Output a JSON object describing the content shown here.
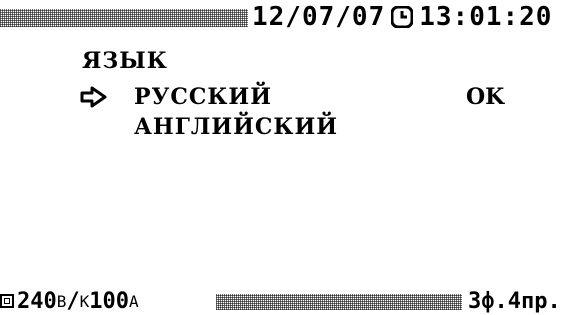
{
  "status_bar": {
    "date": "12/07/07",
    "time": "13:01:20"
  },
  "menu": {
    "title": "ЯЗЫК",
    "items": [
      {
        "label": "РУССКИЙ",
        "status": "OK",
        "selected": true
      },
      {
        "label": "АНГЛИЙСКИЙ",
        "status": "",
        "selected": false
      }
    ]
  },
  "bottom_bar": {
    "voltage_value": "240",
    "voltage_unit": "В",
    "separator": "/",
    "current_prefix": "К",
    "current_value": "100",
    "current_unit": "А",
    "mode": "3ф.4пр."
  },
  "icons": {
    "clock": "clock-icon",
    "pointer": "pointing-hand-icon",
    "source": "square-icon"
  }
}
